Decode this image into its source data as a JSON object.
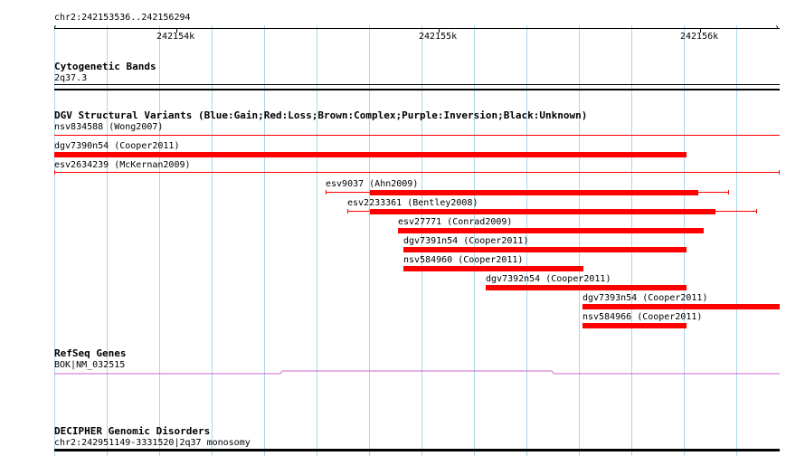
{
  "ruler": {
    "range_label": "chr2:242153536..242156294",
    "ticks": [
      "242154k",
      "242155k",
      "242156k"
    ]
  },
  "tracks": {
    "cytoband": {
      "title": "Cytogenetic Bands",
      "band": "2q37.3"
    },
    "dgv": {
      "title": "DGV Structural Variants (Blue:Gain;Red:Loss;Brown:Complex;Purple:Inversion;Black:Unknown)",
      "first_label": "nsv834588 (Wong2007)",
      "variants": [
        {
          "label": "dgv7390n54 (Cooper2011)"
        },
        {
          "label": "esv2634239 (McKernan2009)"
        },
        {
          "label": "esv9037 (Ahn2009)"
        },
        {
          "label": "esv2233361 (Bentley2008)"
        },
        {
          "label": "esv27771 (Conrad2009)"
        },
        {
          "label": "dgv7391n54 (Cooper2011)"
        },
        {
          "label": "nsv584960 (Cooper2011)"
        },
        {
          "label": "dgv7392n54 (Cooper2011)"
        },
        {
          "label": "dgv7393n54 (Cooper2011)"
        },
        {
          "label": "nsv584966 (Cooper2011)"
        }
      ],
      "color": "#ff0000"
    },
    "refseq": {
      "title": "RefSeq Genes",
      "gene": "BOK|NM_032515",
      "color": "#cc66cc"
    },
    "decipher": {
      "title": "DECIPHER Genomic Disorders",
      "region": "chr2:242951149-3331520|2q37 monosomy"
    }
  },
  "colors": {
    "grid": "#aad8e8",
    "loss": "#ff0000",
    "gene": "#cc66cc"
  }
}
